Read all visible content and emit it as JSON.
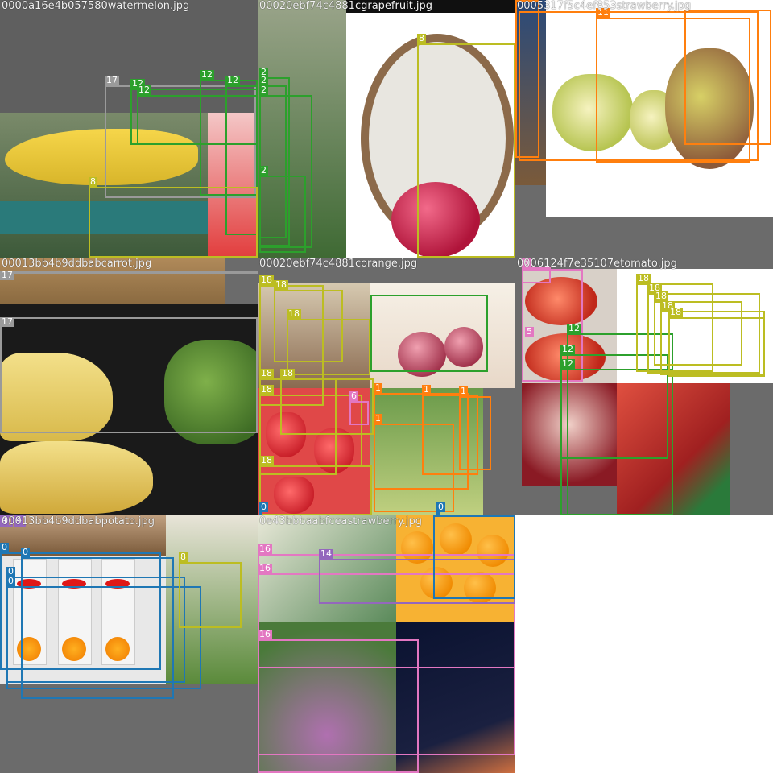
{
  "colors": {
    "green": "#2ca02c",
    "lime": "#bcbd22",
    "orange": "#ff7f0e",
    "gray": "#9a9a9a",
    "pink": "#e377c2",
    "blue": "#1f77b4",
    "violet": "#9467bd",
    "canvas_gray": "#6b6b6b"
  },
  "tiles": [
    {
      "filename": "0000a16e4b057580watermelon.jpg"
    },
    {
      "filename": "00020ebf74c4881cgrapefruit.jpg"
    },
    {
      "filename": "0005317f5c4ef853strawberry.jpg"
    },
    {
      "filename": "00013bb4b9ddbabcarrot.jpg"
    },
    {
      "filename": "00020ebf74c4881corange.jpg"
    },
    {
      "filename": "0006124f7e35107etomato.jpg"
    },
    {
      "filename": "00013bb4b9ddbabpotato.jpg"
    },
    {
      "filename": "0e43bbbaabfceastrawberry.jpg"
    }
  ],
  "labels": {
    "t1": [
      "17",
      "12",
      "12",
      "12",
      "12",
      "8"
    ],
    "t2": [
      "2",
      "2",
      "2",
      "2",
      "8"
    ],
    "t3": [
      "11"
    ],
    "t4": [
      "17",
      "17"
    ],
    "t5": [
      "18",
      "18",
      "18",
      "18",
      "18",
      "18",
      "18",
      "1",
      "1",
      "1",
      "1",
      "6",
      "0",
      "0"
    ],
    "t6": [
      "6",
      "5",
      "12",
      "12",
      "12",
      "18",
      "18",
      "18",
      "18",
      "18"
    ],
    "t7": [
      "4",
      "4",
      "0",
      "0",
      "0",
      "0",
      "8"
    ],
    "t8": [
      "16",
      "16",
      "16",
      "14"
    ]
  }
}
